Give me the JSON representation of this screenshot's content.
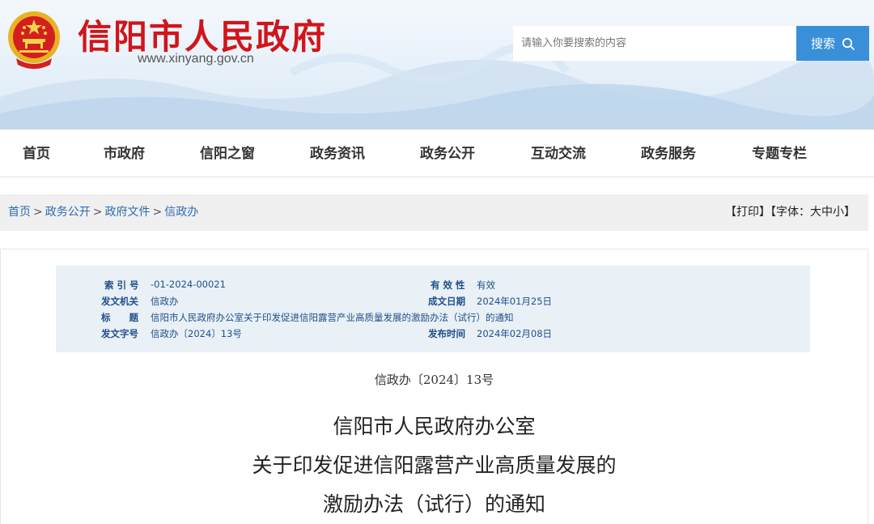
{
  "header": {
    "site_title": "信阳市人民政府",
    "site_url": "www.xinyang.gov.cn",
    "search_placeholder": "请输入你要搜索的内容",
    "search_button": "搜索",
    "brand_red": "#d0151b",
    "accent_blue": "#3a8fd9"
  },
  "nav": {
    "items": [
      "首页",
      "市政府",
      "信阳之窗",
      "政务资讯",
      "政务公开",
      "互动交流",
      "政务服务",
      "专题专栏"
    ]
  },
  "breadcrumb": {
    "items": [
      "首页",
      "政务公开",
      "政府文件",
      "信政办"
    ],
    "separator": ">",
    "print": "【打印】",
    "font_size": "【字体：大中小】"
  },
  "meta": {
    "index_label": "索 引 号",
    "index_value": "-01-2024-00021",
    "validity_label": "有 效 性",
    "validity_value": "有效",
    "issuer_label": "发文机关",
    "issuer_value": "信政办",
    "date_label": "成文日期",
    "date_value": "2024年01月25日",
    "title_label": "标　　题",
    "title_value": "信阳市人民政府办公室关于印发促进信阳露营产业高质量发展的激励办法（试行）的通知",
    "docno_label": "发文字号",
    "docno_value": "信政办〔2024〕13号",
    "publish_label": "发布时间",
    "publish_value": "2024年02月08日"
  },
  "document": {
    "number": "信政办〔2024〕13号",
    "title_lines": [
      "信阳市人民政府办公室",
      "关于印发促进信阳露营产业高质量发展的",
      "激励办法（试行）的通知"
    ]
  }
}
